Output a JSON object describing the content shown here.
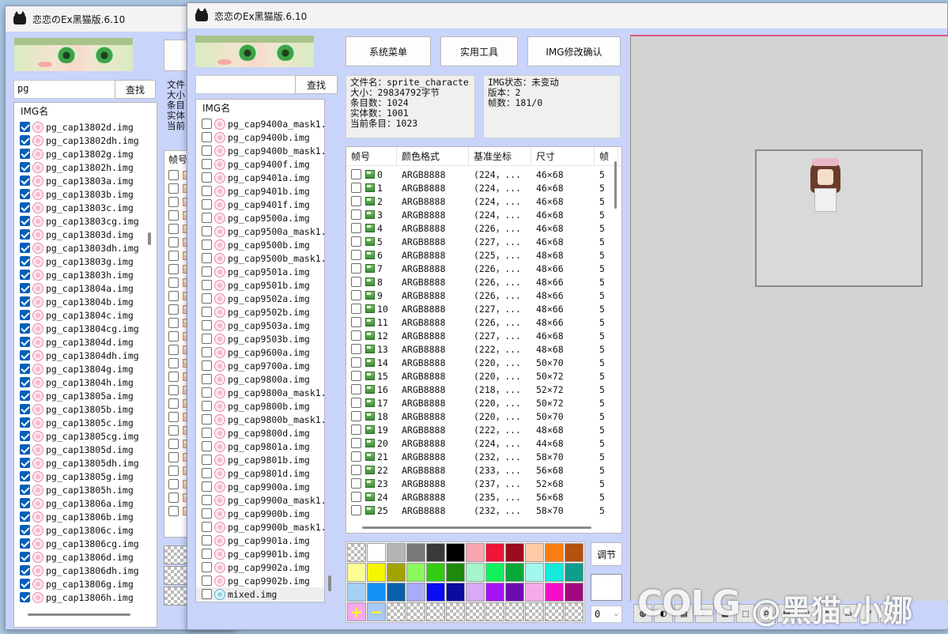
{
  "back_window": {
    "title": "恋恋のEx黑猫版.6.10",
    "search_value": "pg",
    "search_button": "查找",
    "list_header": "IMG名",
    "items": [
      "pg_cap13802d.img",
      "pg_cap13802dh.img",
      "pg_cap13802g.img",
      "pg_cap13802h.img",
      "pg_cap13803a.img",
      "pg_cap13803b.img",
      "pg_cap13803c.img",
      "pg_cap13803cg.img",
      "pg_cap13803d.img",
      "pg_cap13803dh.img",
      "pg_cap13803g.img",
      "pg_cap13803h.img",
      "pg_cap13804a.img",
      "pg_cap13804b.img",
      "pg_cap13804c.img",
      "pg_cap13804cg.img",
      "pg_cap13804d.img",
      "pg_cap13804dh.img",
      "pg_cap13804g.img",
      "pg_cap13804h.img",
      "pg_cap13805a.img",
      "pg_cap13805b.img",
      "pg_cap13805c.img",
      "pg_cap13805cg.img",
      "pg_cap13805d.img",
      "pg_cap13805dh.img",
      "pg_cap13805g.img",
      "pg_cap13805h.img",
      "pg_cap13806a.img",
      "pg_cap13806b.img",
      "pg_cap13806c.img",
      "pg_cap13806cg.img",
      "pg_cap13806d.img",
      "pg_cap13806dh.img",
      "pg_cap13806g.img",
      "pg_cap13806h.img"
    ],
    "partial_labels": [
      "文件",
      "大小",
      "条目",
      "实体",
      "当前"
    ],
    "partial_frame_header": "帧号"
  },
  "front_window": {
    "title": "恋恋のEx黑猫版.6.10",
    "search_value": "",
    "search_button": "查找",
    "list_header": "IMG名",
    "items": [
      "pg_cap9400a_mask1.",
      "pg_cap9400b.img",
      "pg_cap9400b_mask1.",
      "pg_cap9400f.img",
      "pg_cap9401a.img",
      "pg_cap9401b.img",
      "pg_cap9401f.img",
      "pg_cap9500a.img",
      "pg_cap9500a_mask1.",
      "pg_cap9500b.img",
      "pg_cap9500b_mask1.",
      "pg_cap9501a.img",
      "pg_cap9501b.img",
      "pg_cap9502a.img",
      "pg_cap9502b.img",
      "pg_cap9503a.img",
      "pg_cap9503b.img",
      "pg_cap9600a.img",
      "pg_cap9700a.img",
      "pg_cap9800a.img",
      "pg_cap9800a_mask1.",
      "pg_cap9800b.img",
      "pg_cap9800b_mask1.",
      "pg_cap9800d.img",
      "pg_cap9801a.img",
      "pg_cap9801b.img",
      "pg_cap9801d.img",
      "pg_cap9900a.img",
      "pg_cap9900a_mask1.",
      "pg_cap9900b.img",
      "pg_cap9900b_mask1.",
      "pg_cap9901a.img",
      "pg_cap9901b.img",
      "pg_cap9902a.img",
      "pg_cap9902b.img",
      "mixed.img"
    ],
    "buttons": {
      "system_menu": "系统菜单",
      "tools": "实用工具",
      "img_confirm": "IMG修改确认"
    },
    "file_info": [
      "文件名：sprite_characte",
      "大小：29834792字节",
      "条目数：1024",
      "实体数：1001",
      "当前条目：1023"
    ],
    "img_info": [
      "IMG状态：未变动",
      "版本：2",
      "帧数：181/0"
    ],
    "frame_columns": [
      "帧号",
      "颜色格式",
      "基准坐标",
      "尺寸",
      "帧"
    ],
    "frames": [
      [
        "0",
        "ARGB8888",
        "(224，...",
        "46×68",
        "5"
      ],
      [
        "1",
        "ARGB8888",
        "(224，...",
        "46×68",
        "5"
      ],
      [
        "2",
        "ARGB8888",
        "(224，...",
        "46×68",
        "5"
      ],
      [
        "3",
        "ARGB8888",
        "(224，...",
        "46×68",
        "5"
      ],
      [
        "4",
        "ARGB8888",
        "(226，...",
        "46×68",
        "5"
      ],
      [
        "5",
        "ARGB8888",
        "(227，...",
        "46×68",
        "5"
      ],
      [
        "6",
        "ARGB8888",
        "(225，...",
        "48×68",
        "5"
      ],
      [
        "7",
        "ARGB8888",
        "(226，...",
        "48×66",
        "5"
      ],
      [
        "8",
        "ARGB8888",
        "(226，...",
        "48×66",
        "5"
      ],
      [
        "9",
        "ARGB8888",
        "(226，...",
        "48×66",
        "5"
      ],
      [
        "10",
        "ARGB8888",
        "(227，...",
        "48×66",
        "5"
      ],
      [
        "11",
        "ARGB8888",
        "(226，...",
        "48×66",
        "5"
      ],
      [
        "12",
        "ARGB8888",
        "(227，...",
        "46×68",
        "5"
      ],
      [
        "13",
        "ARGB8888",
        "(222，...",
        "48×68",
        "5"
      ],
      [
        "14",
        "ARGB8888",
        "(220，...",
        "50×70",
        "5"
      ],
      [
        "15",
        "ARGB8888",
        "(220，...",
        "50×72",
        "5"
      ],
      [
        "16",
        "ARGB8888",
        "(218，...",
        "52×72",
        "5"
      ],
      [
        "17",
        "ARGB8888",
        "(220，...",
        "50×72",
        "5"
      ],
      [
        "18",
        "ARGB8888",
        "(220，...",
        "50×70",
        "5"
      ],
      [
        "19",
        "ARGB8888",
        "(222，...",
        "48×68",
        "5"
      ],
      [
        "20",
        "ARGB8888",
        "(224，...",
        "44×68",
        "5"
      ],
      [
        "21",
        "ARGB8888",
        "(232，...",
        "58×70",
        "5"
      ],
      [
        "22",
        "ARGB8888",
        "(233，...",
        "56×68",
        "5"
      ],
      [
        "23",
        "ARGB8888",
        "(237，...",
        "52×68",
        "5"
      ],
      [
        "24",
        "ARGB8888",
        "(235，...",
        "56×68",
        "5"
      ],
      [
        "25",
        "ARGB8888",
        "(232，...",
        "58×70",
        "5"
      ]
    ],
    "palette_colors": [
      "transparent",
      "#ffffff",
      "#b4b4b4",
      "#7a7a7a",
      "#3a3a3a",
      "#000000",
      "#f7a5b0",
      "#ef1535",
      "#9c0b1f",
      "#fdcca6",
      "#fa7d12",
      "#b3510d",
      "#fdfd96",
      "#f5f500",
      "#a3a300",
      "#8cf85b",
      "#33cc10",
      "#1e8a0a",
      "#a6f5c9",
      "#12f05c",
      "#08a838",
      "#a2f8ee",
      "#13eadb",
      "#0f9d8e",
      "#a6cff6",
      "#1491f3",
      "#0b5fa8",
      "#a9abf6",
      "#0c0cf5",
      "#0b0ba0",
      "#d7a9f6",
      "#a712f5",
      "#6e0bb0",
      "#f7aaeb",
      "#f20fc7",
      "#a3087f"
    ],
    "adjust_button": "调节",
    "selector_value": "0"
  },
  "watermark": {
    "logo": "COLG",
    "text": "@黑猫·小娜"
  }
}
